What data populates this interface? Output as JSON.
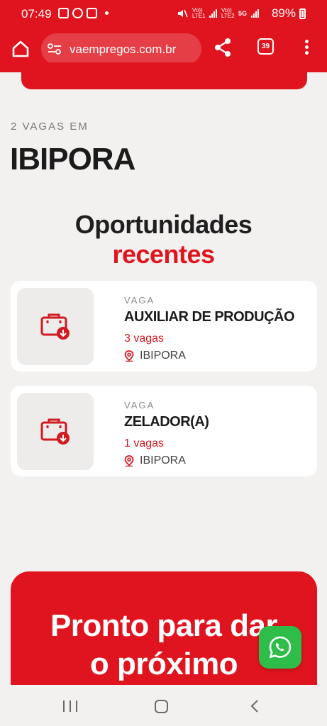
{
  "status_bar": {
    "time": "07:49",
    "network_1": "Vo)) LTE1",
    "network_2": "Vo)) LTE2",
    "network_5g": "5G",
    "battery": "89%"
  },
  "browser": {
    "url": "vaempregos.com.br",
    "tab_count": "39",
    "icons": [
      "home-icon",
      "site-settings-icon",
      "share-icon",
      "tabs-icon",
      "menu-icon"
    ]
  },
  "page": {
    "count_label": "2 VAGAS EM",
    "city": "IBIPORA",
    "section_title_line1": "Oportunidades",
    "section_title_line2": "recentes"
  },
  "jobs": [
    {
      "kicker": "VAGA",
      "title": "AUXILIAR DE PRODUÇÃO",
      "vagas": "3 vagas",
      "location": "IBIPORA"
    },
    {
      "kicker": "VAGA",
      "title": "ZELADOR(A)",
      "vagas": "1 vagas",
      "location": "IBIPORA"
    }
  ],
  "cta": {
    "line1": "Pronto para dar",
    "line2": "o próximo"
  },
  "colors": {
    "brand_red": "#e0141e",
    "whatsapp_green": "#2fbd4a"
  }
}
